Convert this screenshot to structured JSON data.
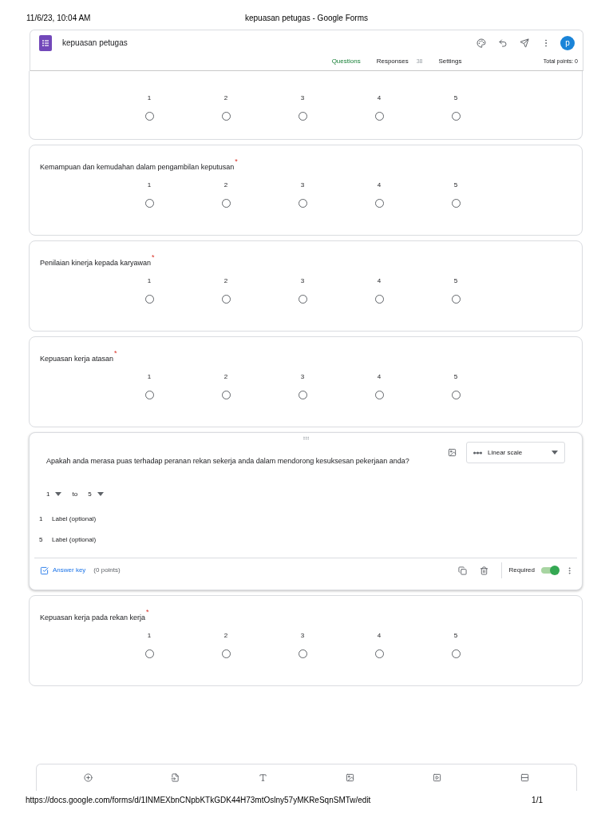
{
  "print_header": {
    "date": "11/6/23, 10:04 AM",
    "title": "kepuasan petugas - Google Forms"
  },
  "form": {
    "title": "kepuasan petugas",
    "avatar": "p"
  },
  "tabs": [
    {
      "label": "Questions",
      "selected": true
    },
    {
      "label": "Responses",
      "count": "38",
      "selected": false
    },
    {
      "label": "Settings",
      "selected": false
    }
  ],
  "total_points": "Total points: 0",
  "questions": [
    {
      "kind": "scale",
      "options": [
        {
          "value": "1",
          "selected": false
        },
        {
          "value": "2",
          "selected": false
        },
        {
          "value": "3",
          "selected": false
        },
        {
          "value": "4",
          "selected": false
        },
        {
          "value": "5",
          "selected": false
        }
      ]
    },
    {
      "kind": "scale",
      "title": "Kemampuan dan kemudahan dalam pengambilan keputusan",
      "required_mark": "*",
      "options": [
        {
          "value": "1",
          "selected": false
        },
        {
          "value": "2",
          "selected": false
        },
        {
          "value": "3",
          "selected": false
        },
        {
          "value": "4",
          "selected": false
        },
        {
          "value": "5",
          "selected": false
        }
      ]
    },
    {
      "kind": "scale",
      "title": "Penilaian kinerja kepada karyawan",
      "required_mark": "*",
      "options": [
        {
          "value": "1",
          "selected": false
        },
        {
          "value": "2",
          "selected": false
        },
        {
          "value": "3",
          "selected": false
        },
        {
          "value": "4",
          "selected": false
        },
        {
          "value": "5",
          "selected": false
        }
      ]
    },
    {
      "kind": "scale",
      "title": "Kepuasan kerja atasan",
      "required_mark": "*",
      "options": [
        {
          "value": "1",
          "selected": false
        },
        {
          "value": "2",
          "selected": false
        },
        {
          "value": "3",
          "selected": false
        },
        {
          "value": "4",
          "selected": false
        },
        {
          "value": "5",
          "selected": false
        }
      ]
    },
    {
      "kind": "editor",
      "title": "Apakah anda merasa puas terhadap peranan rekan sekerja anda dalam mendorong kesuksesan pekerjaan anda?",
      "type": "Linear scale",
      "scale_from": "1",
      "connector": "to",
      "scale_to": "5",
      "labels": [
        {
          "value": "1",
          "placeholder": "Label (optional)"
        },
        {
          "value": "5",
          "placeholder": "Label (optional)"
        }
      ],
      "answer_key": "Answer key",
      "points": "(0 points)",
      "required_label": "Required",
      "required": true
    },
    {
      "kind": "scale",
      "title": "Kepuasan kerja pada rekan kerja",
      "required_mark": "*",
      "options": [
        {
          "value": "1",
          "selected": false
        },
        {
          "value": "2",
          "selected": false
        },
        {
          "value": "3",
          "selected": false
        },
        {
          "value": "4",
          "selected": false
        },
        {
          "value": "5",
          "selected": false
        }
      ]
    }
  ],
  "print_footer": {
    "url": "https://docs.google.com/forms/d/1INMEXbnCNpbKTkGDK44H73mtOslny57yMKReSqnSMTw/edit",
    "page": "1/1"
  }
}
